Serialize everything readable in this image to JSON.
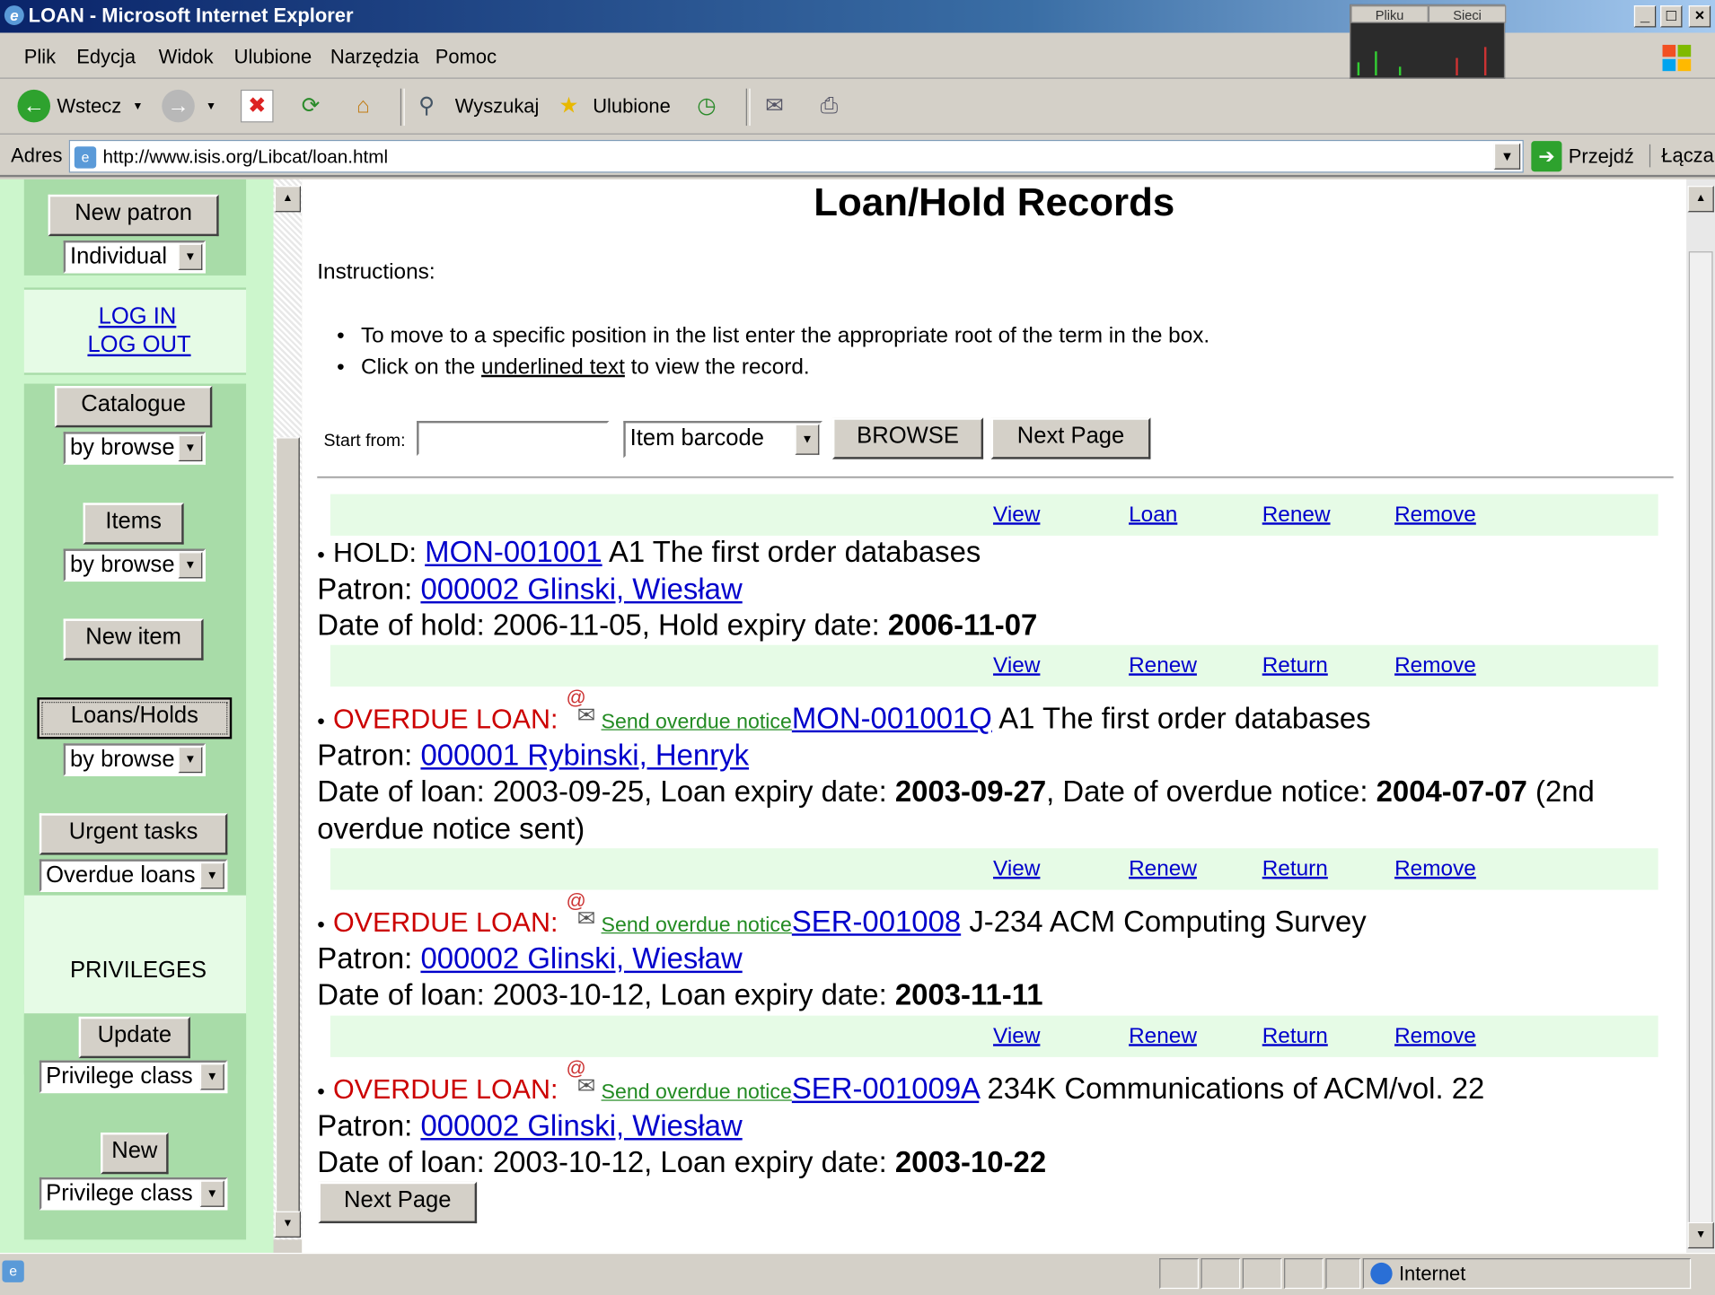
{
  "window": {
    "title": "LOAN - Microsoft Internet Explorer",
    "minimize": "_",
    "maximize": "□",
    "close": "×"
  },
  "netmon": {
    "label1": "Pliku",
    "label2": "Sieci"
  },
  "menu": [
    "Plik",
    "Edycja",
    "Widok",
    "Ulubione",
    "Narzędzia",
    "Pomoc"
  ],
  "toolbar": {
    "back": "Wstecz",
    "search": "Wyszukaj",
    "favorites": "Ulubione"
  },
  "address": {
    "label": "Adres",
    "url": "http://www.isis.org/Libcat/loan.html",
    "go": "Przejdź",
    "links": "Łącza"
  },
  "sidebar": {
    "new_patron": "New patron",
    "patron_type": "Individual",
    "login": "LOG IN",
    "logout": "LOG OUT",
    "catalogue": "Catalogue",
    "catalogue_mode": "by browse",
    "items": "Items",
    "items_mode": "by browse",
    "new_item": "New item",
    "loans": "Loans/Holds",
    "loans_mode": "by browse",
    "urgent": "Urgent tasks",
    "urgent_mode": "Overdue loans",
    "privileges": "PRIVILEGES",
    "update": "Update",
    "update_mode": "Privilege class",
    "new": "New",
    "new_mode": "Privilege class"
  },
  "main": {
    "title": "Loan/Hold Records",
    "instructions": "Instructions:",
    "bullet1": "To move to a specific position in the list enter the appropriate root of the term in the box.",
    "bullet2_pre": "Click on the ",
    "bullet2_link": "underlined text",
    "bullet2_post": " to view the record.",
    "start_from": "Start from:",
    "start_value": "",
    "browse_by": "Item barcode",
    "browse_button": "BROWSE",
    "next_page": "Next Page",
    "notice": "Send overdue notice"
  },
  "records": [
    {
      "actions": [
        "View",
        "Loan",
        "Renew",
        "Remove"
      ],
      "status": "HOLD:",
      "barcode": "MON-001001",
      "item": " A1 The first order databases",
      "patron_label": "Patron: ",
      "patron": "000002 Glinski, Wiesław",
      "date_label": "Date of hold: ",
      "date": "2006-11-05",
      "expiry_label": ", Hold expiry date: ",
      "expiry": "2006-11-07"
    },
    {
      "actions": [
        "View",
        "Renew",
        "Return",
        "Remove"
      ],
      "status": "OVERDUE LOAN:",
      "barcode": "MON-001001Q",
      "item": " A1 The first order databases",
      "patron_label": "Patron: ",
      "patron": "000001 Rybinski, Henryk",
      "date_label": "Date of loan: ",
      "date": "2003-09-25",
      "expiry_label": ", Loan expiry date: ",
      "expiry": "2003-09-27",
      "notice_label": ", Date of overdue notice: ",
      "notice_date": "2004-07-07",
      "notice_tail1": " (2nd",
      "notice_tail2": "overdue notice sent)"
    },
    {
      "actions": [
        "View",
        "Renew",
        "Return",
        "Remove"
      ],
      "status": "OVERDUE LOAN:",
      "barcode": "SER-001008",
      "item": " J-234 ACM Computing Survey",
      "patron_label": "Patron: ",
      "patron": "000002 Glinski, Wiesław",
      "date_label": "Date of loan: ",
      "date": "2003-10-12",
      "expiry_label": ", Loan expiry date: ",
      "expiry": "2003-11-11"
    },
    {
      "actions": [
        "View",
        "Renew",
        "Return",
        "Remove"
      ],
      "status": "OVERDUE LOAN:",
      "barcode": "SER-001009A",
      "item": " 234K Communications of ACM/vol. 22",
      "patron_label": "Patron: ",
      "patron": "000002 Glinski, Wiesław",
      "date_label": "Date of loan: ",
      "date": "2003-10-12",
      "expiry_label": ", Loan expiry date: ",
      "expiry": "2003-10-22"
    }
  ],
  "status": {
    "zone": "Internet"
  }
}
